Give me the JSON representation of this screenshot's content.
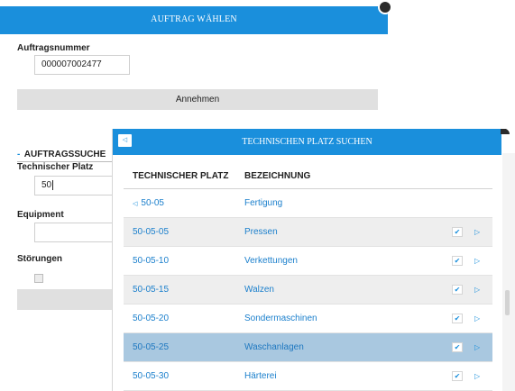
{
  "order_dialog": {
    "title": "AUFTRAG WÄHLEN",
    "order_number_label": "Auftragsnummer",
    "order_number_value": "000007002477",
    "accept_label": "Annehmen"
  },
  "order_search": {
    "section_title": "AUFTRAGSSUCHE",
    "technical_place_label": "Technischer Platz",
    "technical_place_value": "50",
    "equipment_label": "Equipment",
    "equipment_value": "",
    "faults_label": "Störungen"
  },
  "place_search": {
    "title": "TECHNISCHEN PLATZ SUCHEN",
    "columns": [
      "TECHNISCHER PLATZ",
      "BEZEICHNUNG"
    ],
    "parent_row": {
      "place": "50-05",
      "name": "Fertigung"
    },
    "rows": [
      {
        "place": "50-05-05",
        "name": "Pressen"
      },
      {
        "place": "50-05-10",
        "name": "Verkettungen"
      },
      {
        "place": "50-05-15",
        "name": "Walzen"
      },
      {
        "place": "50-05-20",
        "name": "Sondermaschinen"
      },
      {
        "place": "50-05-25",
        "name": "Waschanlagen"
      },
      {
        "place": "50-05-30",
        "name": "Härterei"
      }
    ]
  },
  "icons": {
    "back": "chevron-left-icon",
    "select": "checkmark-icon",
    "drill": "triangle-right-icon",
    "close": "close-circle-icon"
  },
  "colors": {
    "accent": "#1a8fdc",
    "selected_row": "#a9c8e0",
    "header_text": "#ffffff"
  }
}
